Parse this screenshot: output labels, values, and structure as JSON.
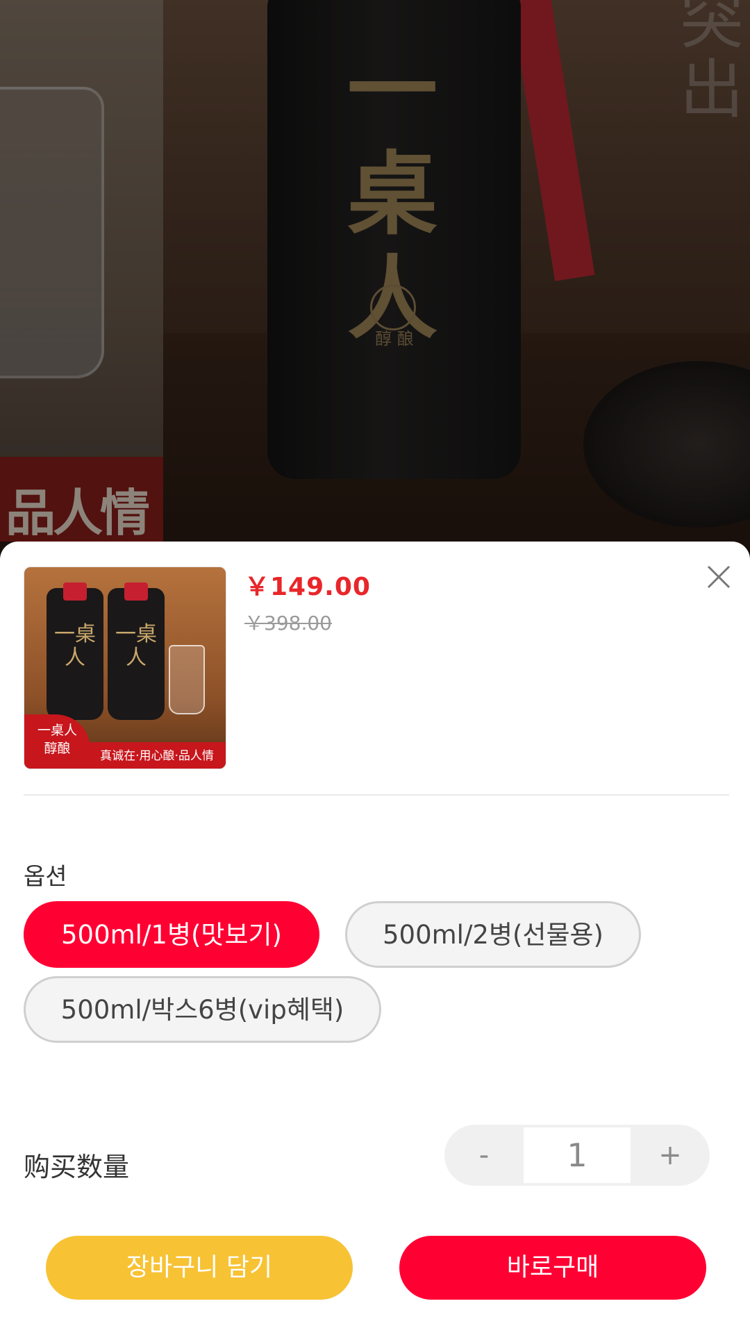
{
  "banner": {
    "left_tag_text": "品人情",
    "bottle_brand": "一桌人",
    "bottle_sub": "醇 酿",
    "right_text": "突出"
  },
  "product": {
    "price": "￥149.00",
    "original_price": "￥398.00",
    "thumb_label_brand": "一桌人",
    "thumb_badge_line1": "一桌人",
    "thumb_badge_line2": "醇酿",
    "thumb_strip_text": "真诚在·用心酿·品人情"
  },
  "options": {
    "title": "옵션",
    "items": [
      {
        "label": "500ml/1병(맛보기)",
        "selected": true
      },
      {
        "label": "500ml/2병(선물용)",
        "selected": false
      },
      {
        "label": "500ml/박스6병(vip혜택)",
        "selected": false
      }
    ]
  },
  "quantity": {
    "label": "购买数量",
    "minus": "-",
    "value": "1",
    "plus": "+"
  },
  "actions": {
    "add_to_cart": "장바구니 담기",
    "buy_now": "바로구매"
  },
  "colors": {
    "price_red": "#e8262a",
    "accent_red": "#ff0033",
    "cart_yellow": "#f7c234"
  },
  "icons": {
    "close": "close-icon"
  }
}
